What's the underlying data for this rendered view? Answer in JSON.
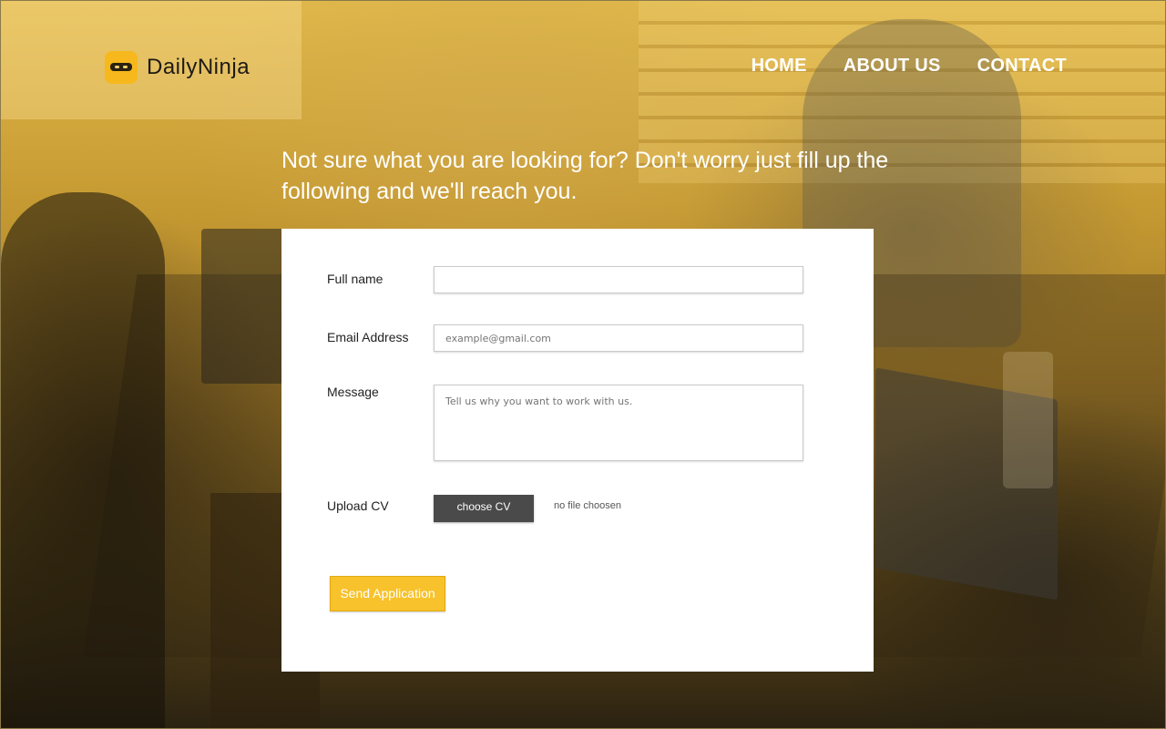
{
  "brand": {
    "name": "DailyNinja",
    "logo_icon": "ninja-icon",
    "logo_color": "#f6b81c"
  },
  "nav": {
    "items": [
      {
        "label": "HOME"
      },
      {
        "label": "ABOUT US"
      },
      {
        "label": "CONTACT"
      }
    ]
  },
  "headline": "Not sure what you are looking for? Don't worry just fill up the following and we'll reach you.",
  "form": {
    "full_name": {
      "label": "Full name",
      "value": "",
      "placeholder": ""
    },
    "email": {
      "label": "Email Address",
      "value": "",
      "placeholder": "example@gmail.com"
    },
    "message": {
      "label": "Message",
      "value": "",
      "placeholder": "Tell us why you want to work with us."
    },
    "upload": {
      "label": "Upload CV",
      "button_label": "choose CV",
      "status": "no file choosen"
    },
    "submit_label": "Send Application"
  },
  "colors": {
    "accent": "#f7c22c",
    "button_dark": "#4a4a4a",
    "card_bg": "#ffffff"
  }
}
